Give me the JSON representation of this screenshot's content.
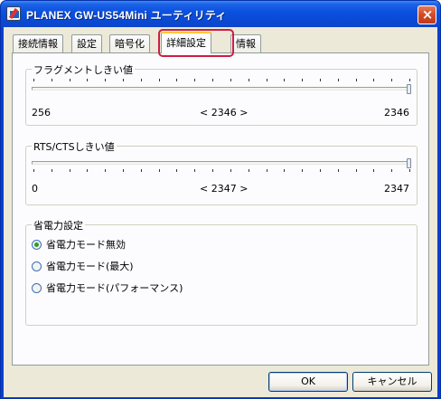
{
  "window": {
    "title": "PLANEX GW-US54Mini ユーティリティ",
    "close_glyph": "×"
  },
  "tabs": [
    {
      "label": "接続情報",
      "active": false
    },
    {
      "label": "設定",
      "active": false
    },
    {
      "label": "暗号化",
      "active": false
    },
    {
      "label": "詳細設定",
      "active": true
    },
    {
      "label": "情報",
      "active": false
    }
  ],
  "fragment": {
    "label": "フラグメントしきい値",
    "min_label": "256",
    "current_label": "< 2346 >",
    "max_label": "2346",
    "min": 256,
    "max": 2346,
    "value": 2346
  },
  "rts": {
    "label": "RTS/CTSしきい値",
    "min_label": "0",
    "current_label": "< 2347 >",
    "max_label": "2347",
    "min": 0,
    "max": 2347,
    "value": 2347
  },
  "power": {
    "label": "省電力設定",
    "options": [
      {
        "label": "省電力モード無効",
        "checked": true
      },
      {
        "label": "省電力モード(最大)",
        "checked": false
      },
      {
        "label": "省電力モード(パフォーマンス)",
        "checked": false
      }
    ]
  },
  "buttons": {
    "ok": "OK",
    "cancel": "キャンセル"
  },
  "colors": {
    "titlebar": "#0a4ad6",
    "highlight": "#cc1d43",
    "dialog_bg": "#ece9d8"
  },
  "icons": {
    "app": "network-adapter-icon",
    "close": "close-icon",
    "radio_selected": "radio-selected-icon"
  }
}
